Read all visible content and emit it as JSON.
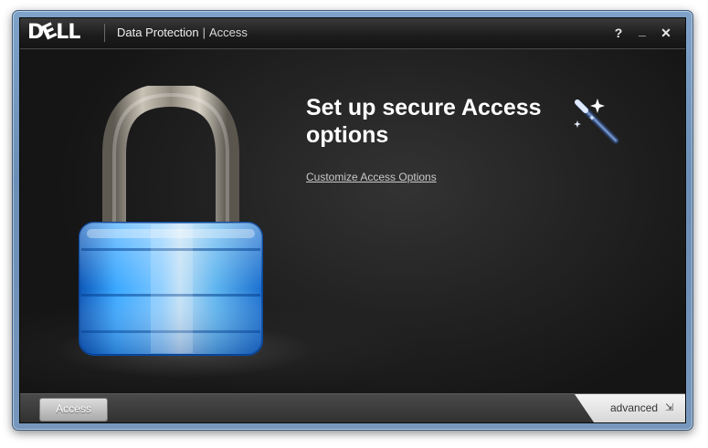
{
  "window": {
    "brand": "DELL",
    "title": "Data Protection",
    "title_separator": "|",
    "subtitle": "Access",
    "controls": {
      "help": "?",
      "minimize": "_",
      "close": "✕"
    }
  },
  "main": {
    "heading": "Set up secure Access options",
    "link": "Customize Access Options",
    "illustration": "padlock-icon",
    "wand_icon": "magic-wand-icon"
  },
  "footer": {
    "tab_label": "Access",
    "advanced_label": "advanced",
    "advanced_icon": "⇲"
  },
  "colors": {
    "background": "#1c1c1c",
    "frame": "#6b8fb8",
    "lock_blue": "#3aa8ff"
  }
}
